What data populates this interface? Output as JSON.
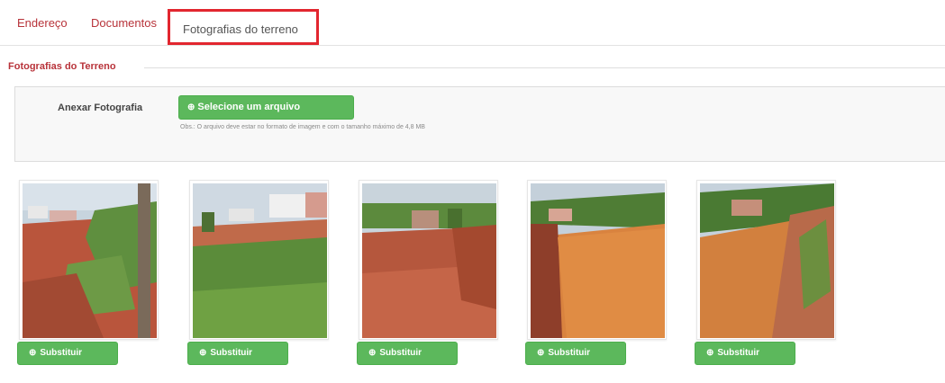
{
  "tabs": [
    {
      "label": "Endereço"
    },
    {
      "label": "Documentos"
    },
    {
      "label": "Fotografias do terreno",
      "active": true
    }
  ],
  "section": {
    "legend": "Fotografias do Terreno",
    "upload_label": "Anexar Fotografia",
    "select_button": "Selecione um arquivo",
    "select_icon": "upload-icon",
    "hint": "Obs.: O arquivo deve estar no formato de imagem e com o tamanho máximo de 4,8 MB"
  },
  "photos": [
    {
      "scene": "terrain-road-green",
      "replace_label": "Substituir"
    },
    {
      "scene": "terrain-grass-houses",
      "replace_label": "Substituir"
    },
    {
      "scene": "terrain-dirt-field",
      "replace_label": "Substituir"
    },
    {
      "scene": "terrain-orange-slope",
      "replace_label": "Substituir"
    },
    {
      "scene": "terrain-orange-hill",
      "replace_label": "Substituir"
    }
  ],
  "colors": {
    "tab_text": "#b8333a",
    "active_tab_border": "#e2262f",
    "button_green": "#5cb85c"
  }
}
